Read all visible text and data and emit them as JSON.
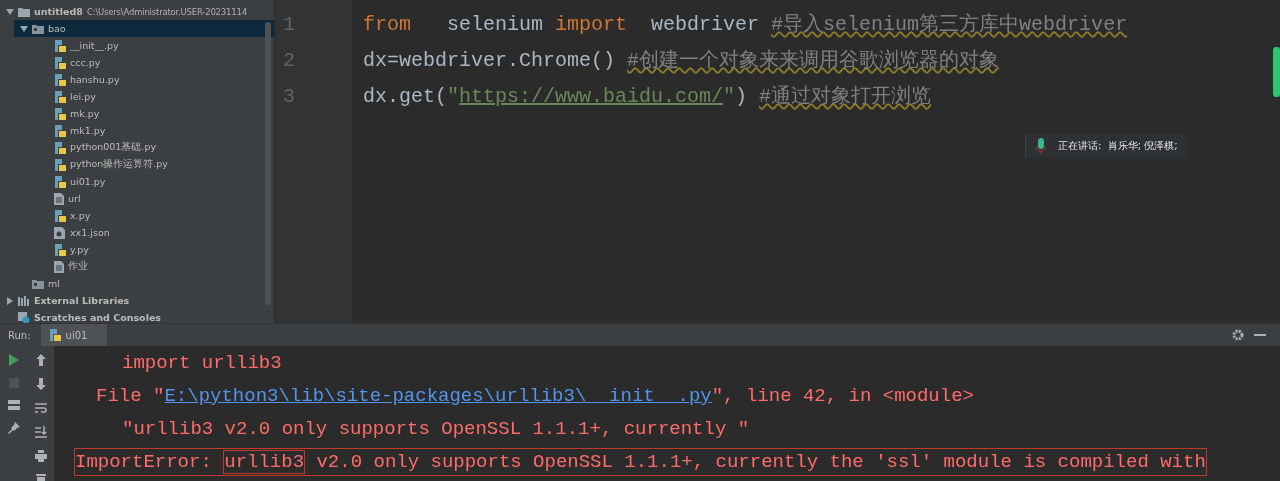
{
  "project_tree": [
    {
      "label": "untitled8",
      "path": "C:\\Users\\Administrator.USER-20231114",
      "kind": "folder",
      "expanded": true,
      "selected": false,
      "children": [
        {
          "label": "bao",
          "kind": "package",
          "expanded": true,
          "selected": true,
          "children": [
            {
              "label": "__init__.py",
              "kind": "python",
              "selected": false
            },
            {
              "label": "ccc.py",
              "kind": "python",
              "selected": false
            },
            {
              "label": "hanshu.py",
              "kind": "python",
              "selected": false
            },
            {
              "label": "lei.py",
              "kind": "python",
              "selected": false
            },
            {
              "label": "mk.py",
              "kind": "python",
              "selected": false
            },
            {
              "label": "mk1.py",
              "kind": "python",
              "selected": false
            },
            {
              "label": "python001基础.py",
              "kind": "python",
              "selected": false
            },
            {
              "label": "python操作运算符.py",
              "kind": "python",
              "selected": false
            },
            {
              "label": "ui01.py",
              "kind": "python",
              "selected": false
            },
            {
              "label": "url",
              "kind": "text",
              "selected": false
            },
            {
              "label": "x.py",
              "kind": "python",
              "selected": false
            },
            {
              "label": "xx1.json",
              "kind": "json",
              "selected": false
            },
            {
              "label": "y.py",
              "kind": "python",
              "selected": false
            },
            {
              "label": "作业",
              "kind": "text",
              "selected": false
            }
          ]
        },
        {
          "label": "ml",
          "kind": "package",
          "selected": false
        }
      ]
    },
    {
      "label": "External Libraries",
      "kind": "library",
      "expanded": false,
      "selected": false
    },
    {
      "label": "Scratches and Consoles",
      "kind": "scratch",
      "selected": false
    }
  ],
  "editor": {
    "lines": [
      {
        "number": "1",
        "tokens": [
          {
            "text": "from",
            "kind": "keyword"
          },
          {
            "text": "   selenium ",
            "kind": "plain"
          },
          {
            "text": "import",
            "kind": "keyword"
          },
          {
            "text": "  webdriver ",
            "kind": "plain"
          },
          {
            "text": "#导入selenium第三方库中webdriver",
            "kind": "comment"
          }
        ]
      },
      {
        "number": "2",
        "tokens": [
          {
            "text": "dx=webdriver.Chrome() ",
            "kind": "plain"
          },
          {
            "text": "#创建一个对象来来调用谷歌浏览器的对象",
            "kind": "comment"
          }
        ]
      },
      {
        "number": "3",
        "tokens": [
          {
            "text": "dx.get(",
            "kind": "plain"
          },
          {
            "text": "\"",
            "kind": "string"
          },
          {
            "text": "https://www.baidu.com/",
            "kind": "link"
          },
          {
            "text": "\"",
            "kind": "string"
          },
          {
            "text": ") ",
            "kind": "plain"
          },
          {
            "text": "#通过对象打开浏览",
            "kind": "comment"
          }
        ]
      }
    ]
  },
  "speaking_popup": {
    "text": "正在讲话:  肖乐华; 倪泽棋;"
  },
  "run_panel": {
    "label": "Run:",
    "tabs": [
      {
        "label": "ui01",
        "selected": true
      }
    ],
    "output": [
      {
        "kind": "source",
        "segments": [
          {
            "text": "import urllib3",
            "kind": "text"
          }
        ]
      },
      {
        "kind": "frame",
        "segments": [
          {
            "text": "File \"",
            "kind": "text"
          },
          {
            "text": "E:\\python3\\lib\\site-packages\\urllib3\\__init__.py",
            "kind": "link"
          },
          {
            "text": "\", line 42, in <module>",
            "kind": "text"
          }
        ]
      },
      {
        "kind": "source",
        "segments": [
          {
            "text": "\"urllib3 v2.0 only supports OpenSSL 1.1.1+, currently \"",
            "kind": "text"
          }
        ]
      },
      {
        "kind": "error",
        "segments": [
          {
            "text": "ImportError: ",
            "kind": "text"
          },
          {
            "text": "urllib3",
            "kind": "boxed"
          },
          {
            "text": " v2.0 only supports OpenSSL 1.1.1+, currently the 'ssl' module is compiled with",
            "kind": "text"
          }
        ]
      }
    ]
  }
}
